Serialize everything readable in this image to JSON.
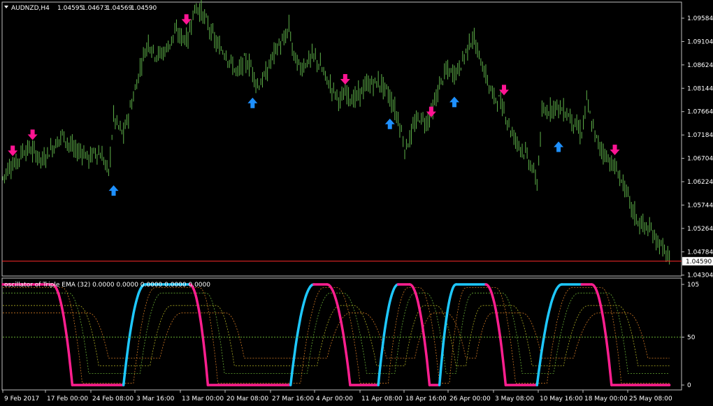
{
  "header": {
    "symbol": "AUDNZD,H4",
    "open": "1.04595",
    "high": "1.04673",
    "low": "1.04569",
    "close": "1.04590"
  },
  "indicator": {
    "title": "oscillator of Triple EMA (32) 0.0000 0.0000 0.0000 0.0000 0.0000"
  },
  "colors": {
    "background": "#000000",
    "candles": "#5fb34a",
    "up_arrow": "#1e90ff",
    "down_arrow": "#ff1493",
    "price_line": "#ff2a2a",
    "osc_up": "#1ec8ff",
    "osc_down": "#ff1f8f",
    "dotted_green": "#66aa33",
    "dotted_orange": "#cc7722",
    "dotted_yellow": "#aaaa22"
  },
  "chart_data": [
    {
      "type": "candlestick",
      "title": "AUDNZD,H4",
      "ylim": [
        1.043,
        1.099
      ],
      "y_ticks": [
        "1.09584",
        "1.09104",
        "1.08624",
        "1.08144",
        "1.07664",
        "1.07184",
        "1.06704",
        "1.06224",
        "1.05744",
        "1.05264",
        "1.04784",
        "1.04304"
      ],
      "current_price": "1.04590",
      "x_ticks": [
        "9 Feb 2017",
        "17 Feb 00:00",
        "24 Feb 08:00",
        "3 Mar 16:00",
        "13 Mar 00:00",
        "20 Mar 08:00",
        "27 Mar 16:00",
        "4 Apr 00:00",
        "11 Apr 08:00",
        "18 Apr 16:00",
        "26 Apr 00:00",
        "3 May 08:00",
        "10 May 16:00",
        "18 May 00:00",
        "25 May 08:00"
      ],
      "price_path": [
        [
          0,
          1.063
        ],
        [
          4,
          1.0655
        ],
        [
          8,
          1.066
        ],
        [
          12,
          1.0685
        ],
        [
          16,
          1.069
        ],
        [
          20,
          1.068
        ],
        [
          24,
          1.0665
        ],
        [
          28,
          1.0685
        ],
        [
          32,
          1.07
        ],
        [
          36,
          1.072
        ],
        [
          40,
          1.07
        ],
        [
          44,
          1.0685
        ],
        [
          48,
          1.0685
        ],
        [
          52,
          1.067
        ],
        [
          56,
          1.0685
        ],
        [
          60,
          1.0675
        ],
        [
          64,
          1.064
        ],
        [
          67,
          1.0755
        ],
        [
          70,
          1.0735
        ],
        [
          73,
          1.072
        ],
        [
          76,
          1.076
        ],
        [
          80,
          1.081
        ],
        [
          84,
          1.087
        ],
        [
          88,
          1.091
        ],
        [
          92,
          1.0885
        ],
        [
          96,
          1.0885
        ],
        [
          100,
          1.09
        ],
        [
          104,
          1.093
        ],
        [
          108,
          1.092
        ],
        [
          112,
          1.0915
        ],
        [
          115,
          1.097
        ],
        [
          118,
          1.098
        ],
        [
          122,
          1.096
        ],
        [
          126,
          1.093
        ],
        [
          130,
          1.09
        ],
        [
          134,
          1.089
        ],
        [
          138,
          1.0865
        ],
        [
          142,
          1.0845
        ],
        [
          146,
          1.087
        ],
        [
          150,
          1.086
        ],
        [
          154,
          1.082
        ],
        [
          157,
          1.083
        ],
        [
          160,
          1.085
        ],
        [
          163,
          1.088
        ],
        [
          166,
          1.09
        ],
        [
          170,
          1.091
        ],
        [
          173,
          1.094
        ],
        [
          176,
          1.088
        ],
        [
          180,
          1.0855
        ],
        [
          184,
          1.087
        ],
        [
          188,
          1.088
        ],
        [
          192,
          1.086
        ],
        [
          196,
          1.083
        ],
        [
          200,
          1.081
        ],
        [
          204,
          1.079
        ],
        [
          208,
          1.0805
        ],
        [
          212,
          1.079
        ],
        [
          216,
          1.0805
        ],
        [
          220,
          1.082
        ],
        [
          224,
          1.0825
        ],
        [
          228,
          1.0825
        ],
        [
          232,
          1.081
        ],
        [
          236,
          1.078
        ],
        [
          240,
          1.074
        ],
        [
          243,
          1.069
        ],
        [
          246,
          1.071
        ],
        [
          249,
          1.074
        ],
        [
          252,
          1.0755
        ],
        [
          256,
          1.0745
        ],
        [
          260,
          1.077
        ],
        [
          264,
          1.082
        ],
        [
          268,
          1.085
        ],
        [
          272,
          1.0845
        ],
        [
          276,
          1.0855
        ],
        [
          280,
          1.089
        ],
        [
          284,
          1.092
        ],
        [
          288,
          1.088
        ],
        [
          292,
          1.084
        ],
        [
          296,
          1.08
        ],
        [
          300,
          1.079
        ],
        [
          304,
          1.076
        ],
        [
          308,
          1.072
        ],
        [
          312,
          1.07
        ],
        [
          316,
          1.068
        ],
        [
          320,
          1.065
        ],
        [
          323,
          1.062
        ],
        [
          326,
          1.076
        ],
        [
          330,
          1.077
        ],
        [
          334,
          1.078
        ],
        [
          338,
          1.077
        ],
        [
          342,
          1.076
        ],
        [
          346,
          1.074
        ],
        [
          350,
          1.072
        ],
        [
          353,
          1.079
        ],
        [
          356,
          1.074
        ],
        [
          360,
          1.07
        ],
        [
          364,
          1.068
        ],
        [
          368,
          1.066
        ],
        [
          372,
          1.064
        ],
        [
          376,
          1.061
        ],
        [
          380,
          1.057
        ],
        [
          384,
          1.054
        ],
        [
          388,
          1.053
        ],
        [
          392,
          1.052
        ],
        [
          396,
          1.05
        ],
        [
          400,
          1.048
        ],
        [
          403,
          1.0459
        ]
      ],
      "signals": [
        {
          "bar": 6,
          "dir": "down",
          "price": 1.0675
        },
        {
          "bar": 18,
          "dir": "down",
          "price": 1.0708
        },
        {
          "bar": 67,
          "dir": "up",
          "price": 1.0615
        },
        {
          "bar": 111,
          "dir": "down",
          "price": 1.0945
        },
        {
          "bar": 151,
          "dir": "up",
          "price": 1.0795
        },
        {
          "bar": 207,
          "dir": "down",
          "price": 1.0822
        },
        {
          "bar": 234,
          "dir": "up",
          "price": 1.0752
        },
        {
          "bar": 259,
          "dir": "down",
          "price": 1.0755
        },
        {
          "bar": 273,
          "dir": "up",
          "price": 1.0797
        },
        {
          "bar": 303,
          "dir": "down",
          "price": 1.08
        },
        {
          "bar": 336,
          "dir": "up",
          "price": 1.0705
        },
        {
          "bar": 370,
          "dir": "down",
          "price": 1.0677
        }
      ]
    },
    {
      "type": "line",
      "title": "oscillator of Triple EMA (32)",
      "ylim": [
        0,
        105
      ],
      "y_ticks": [
        "105",
        "50",
        "0"
      ],
      "levels": [
        50
      ],
      "segments": [
        {
          "x0": 0,
          "x1": 30,
          "y0": 105,
          "y1": 105,
          "color": "down"
        },
        {
          "x0": 30,
          "x1": 42,
          "y0": 105,
          "y1": 0,
          "color": "down",
          "curve": "ease-in"
        },
        {
          "x0": 42,
          "x1": 73,
          "y0": 0,
          "y1": 0,
          "color": "down"
        },
        {
          "x0": 73,
          "x1": 86,
          "y0": 0,
          "y1": 105,
          "color": "up",
          "curve": "ease-out"
        },
        {
          "x0": 86,
          "x1": 113,
          "y0": 105,
          "y1": 105,
          "color": "up"
        },
        {
          "x0": 113,
          "x1": 124,
          "y0": 105,
          "y1": 0,
          "color": "down",
          "curve": "ease-in"
        },
        {
          "x0": 124,
          "x1": 174,
          "y0": 0,
          "y1": 0,
          "color": "down"
        },
        {
          "x0": 174,
          "x1": 188,
          "y0": 0,
          "y1": 105,
          "color": "up",
          "curve": "ease-out"
        },
        {
          "x0": 188,
          "x1": 196,
          "y0": 105,
          "y1": 105,
          "color": "down"
        },
        {
          "x0": 196,
          "x1": 210,
          "y0": 105,
          "y1": 0,
          "color": "down",
          "curve": "ease-in"
        },
        {
          "x0": 210,
          "x1": 227,
          "y0": 0,
          "y1": 0,
          "color": "down"
        },
        {
          "x0": 227,
          "x1": 239,
          "y0": 0,
          "y1": 105,
          "color": "up",
          "curve": "ease-out"
        },
        {
          "x0": 239,
          "x1": 246,
          "y0": 105,
          "y1": 105,
          "color": "down"
        },
        {
          "x0": 246,
          "x1": 258,
          "y0": 105,
          "y1": 0,
          "color": "down",
          "curve": "ease-in"
        },
        {
          "x0": 258,
          "x1": 264,
          "y0": 0,
          "y1": 0,
          "color": "down"
        },
        {
          "x0": 264,
          "x1": 274,
          "y0": 0,
          "y1": 105,
          "color": "up",
          "curve": "ease-out"
        },
        {
          "x0": 274,
          "x1": 292,
          "y0": 105,
          "y1": 105,
          "color": "up"
        },
        {
          "x0": 292,
          "x1": 304,
          "y0": 105,
          "y1": 0,
          "color": "down",
          "curve": "ease-in"
        },
        {
          "x0": 304,
          "x1": 323,
          "y0": 0,
          "y1": 0,
          "color": "down"
        },
        {
          "x0": 323,
          "x1": 338,
          "y0": 0,
          "y1": 105,
          "color": "up",
          "curve": "ease-out"
        },
        {
          "x0": 338,
          "x1": 350,
          "y0": 105,
          "y1": 105,
          "color": "up"
        },
        {
          "x0": 350,
          "x1": 356,
          "y0": 105,
          "y1": 105,
          "color": "down"
        },
        {
          "x0": 356,
          "x1": 368,
          "y0": 105,
          "y1": 0,
          "color": "down",
          "curve": "ease-in"
        },
        {
          "x0": 368,
          "x1": 403,
          "y0": 0,
          "y1": 0,
          "color": "down"
        }
      ]
    }
  ]
}
